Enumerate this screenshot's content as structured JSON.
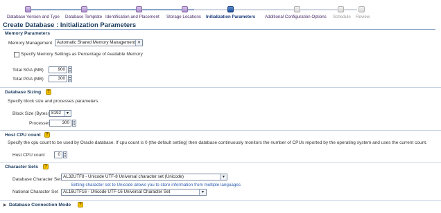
{
  "wizard": {
    "steps": [
      {
        "label": "Database Version and Type",
        "state": "done"
      },
      {
        "label": "Database Template",
        "state": "done"
      },
      {
        "label": "Identification and Placement",
        "state": "done"
      },
      {
        "label": "Storage Locations",
        "state": "done"
      },
      {
        "label": "Initialization Parameters",
        "state": "current"
      },
      {
        "label": "Additional Configuration Options",
        "state": "todo"
      },
      {
        "label": "Schedule",
        "state": "todo"
      },
      {
        "label": "Review",
        "state": "todo"
      }
    ]
  },
  "page": {
    "title": "Create Database : Initialization Parameters"
  },
  "memory": {
    "heading": "Memory Parameters",
    "management_label": "Memory Management",
    "management_value": "Automatic Shared Memory Management",
    "percentage_label": "Specify Memory Settings as Percentage of Available Memory",
    "sga_label": "Total SGA (MB)",
    "sga_value": "900",
    "pga_label": "Total PGA (MB)",
    "pga_value": "300"
  },
  "sizing": {
    "heading": "Database Sizing",
    "description": "Specify block size and processes parameters.",
    "block_label": "Block Size (Bytes)",
    "block_value": "8192",
    "processes_label": "Processes",
    "processes_value": "300"
  },
  "cpu": {
    "heading": "Host CPU count",
    "description": "Specify the cpu count to be used by Oracle database. If cpu count is 0 (the default setting) then database continuously monitors the number of CPUs reported by the operating system and uses the current count.",
    "count_label": "Host CPU count",
    "count_value": "0"
  },
  "charsets": {
    "heading": "Character Sets",
    "db_label": "Database Character Set",
    "db_value": "AL32UTF8 - Unicode UTF-8 Universal character set (Unicode)",
    "hint": "Setting character set to Unicode allows you to store information from multiple languages",
    "national_label": "National Character Set",
    "national_value": "AL16UTF16 - Unicode UTF-16 Universal Character Set"
  },
  "connection": {
    "heading": "Database Connection Mode"
  },
  "icons": {
    "help": "help-icon",
    "dropdown": "chevron-down-icon",
    "expand": "triangle-right-icon"
  }
}
